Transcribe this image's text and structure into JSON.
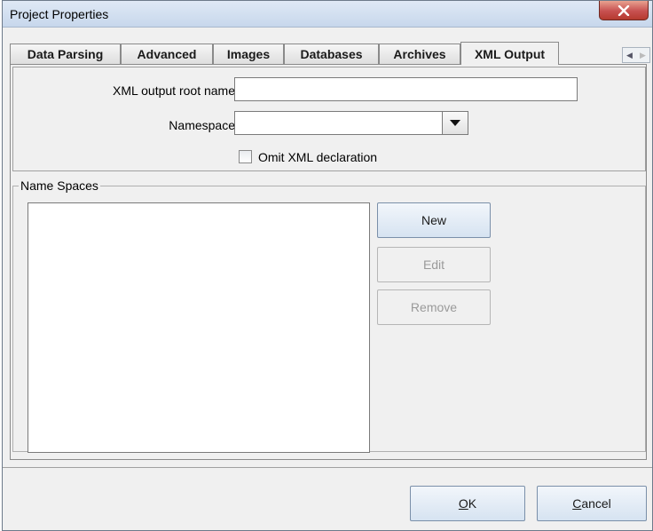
{
  "window": {
    "title": "Project Properties",
    "close_icon": "close-icon"
  },
  "tabs": [
    {
      "label": "Data Parsing",
      "active": false
    },
    {
      "label": "Advanced",
      "active": false
    },
    {
      "label": "Images",
      "active": false
    },
    {
      "label": "Databases",
      "active": false
    },
    {
      "label": "Archives",
      "active": false
    },
    {
      "label": "XML Output",
      "active": true
    }
  ],
  "tab_scroll": {
    "left_icon": "chevron-left-icon",
    "right_icon": "chevron-right-icon"
  },
  "xml_output": {
    "root_name_label": "XML output root name",
    "root_name_value": "",
    "namespace_label": "Namespace",
    "namespace_value": "",
    "omit_declaration_label": "Omit XML declaration",
    "omit_declaration_checked": false
  },
  "name_spaces": {
    "group_title": "Name Spaces",
    "items": [],
    "new_label": "New",
    "edit_label": "Edit",
    "remove_label": "Remove"
  },
  "footer": {
    "ok_label": "OK",
    "cancel_label": "Cancel"
  }
}
